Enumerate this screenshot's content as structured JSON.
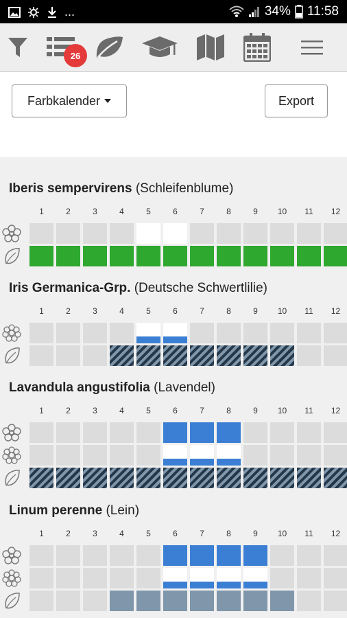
{
  "status": {
    "percent": "34%",
    "time": "11:58",
    "dots": "..."
  },
  "toolbar": {
    "badge": "26"
  },
  "controls": {
    "calendar_label": "Farbkalender",
    "export_label": "Export"
  },
  "months": [
    "1",
    "2",
    "3",
    "4",
    "5",
    "6",
    "7",
    "8",
    "9",
    "10",
    "11",
    "12"
  ],
  "plants": [
    {
      "latin": "Iberis sempervirens",
      "common": "(Schleifenblume)"
    },
    {
      "latin": "Iris Germanica-Grp.",
      "common": "(Deutsche Schwertlilie)"
    },
    {
      "latin": "Lavandula angustifolia",
      "common": "(Lavendel)"
    },
    {
      "latin": "Linum perenne",
      "common": "(Lein)"
    }
  ],
  "rows": {
    "p0": {
      "flower": [
        "g",
        "g",
        "g",
        "g",
        "w",
        "w",
        "g",
        "g",
        "g",
        "g",
        "g",
        "g"
      ],
      "leaf": [
        "G",
        "G",
        "G",
        "G",
        "G",
        "G",
        "G",
        "G",
        "G",
        "G",
        "G",
        "G"
      ]
    },
    "p1": {
      "flower2": [
        "g",
        "g",
        "g",
        "g",
        "wb",
        "wb",
        "g",
        "g",
        "g",
        "g",
        "g",
        "g"
      ],
      "leaf": [
        "g",
        "g",
        "g",
        "h",
        "h",
        "h",
        "h",
        "h",
        "h",
        "h",
        "g",
        "g"
      ]
    },
    "p2": {
      "flower": [
        "g",
        "g",
        "g",
        "g",
        "g",
        "B",
        "B",
        "B",
        "g",
        "g",
        "g",
        "g"
      ],
      "flower2": [
        "g",
        "g",
        "g",
        "g",
        "g",
        "wb",
        "wb",
        "wb",
        "g",
        "g",
        "g",
        "g"
      ],
      "leaf": [
        "h",
        "h",
        "h",
        "h",
        "h",
        "h",
        "h",
        "h",
        "h",
        "h",
        "h",
        "h"
      ]
    },
    "p3": {
      "flower": [
        "g",
        "g",
        "g",
        "g",
        "g",
        "B",
        "B",
        "B",
        "B",
        "g",
        "g",
        "g"
      ],
      "flower2": [
        "g",
        "g",
        "g",
        "g",
        "g",
        "wb",
        "wb",
        "wb",
        "wb",
        "g",
        "g",
        "g"
      ],
      "leaf": [
        "g",
        "g",
        "g",
        "s",
        "s",
        "s",
        "s",
        "s",
        "s",
        "s",
        "g",
        "g"
      ]
    }
  },
  "colors": {
    "green": "#2ea82e",
    "blue": "#3b7fd4",
    "badge": "#e43a3a",
    "slate": "#7f96ab",
    "hatch_dark": "#253849"
  },
  "icons": [
    "image-icon",
    "brightness-icon",
    "download-icon",
    "wifi-icon",
    "signal-icon",
    "battery-icon",
    "filter-icon",
    "list-icon",
    "leaf-icon",
    "graduation-cap-icon",
    "map-icon",
    "calendar-icon",
    "menu-icon",
    "flower-icon",
    "double-flower-icon",
    "leaf-outline-icon"
  ]
}
